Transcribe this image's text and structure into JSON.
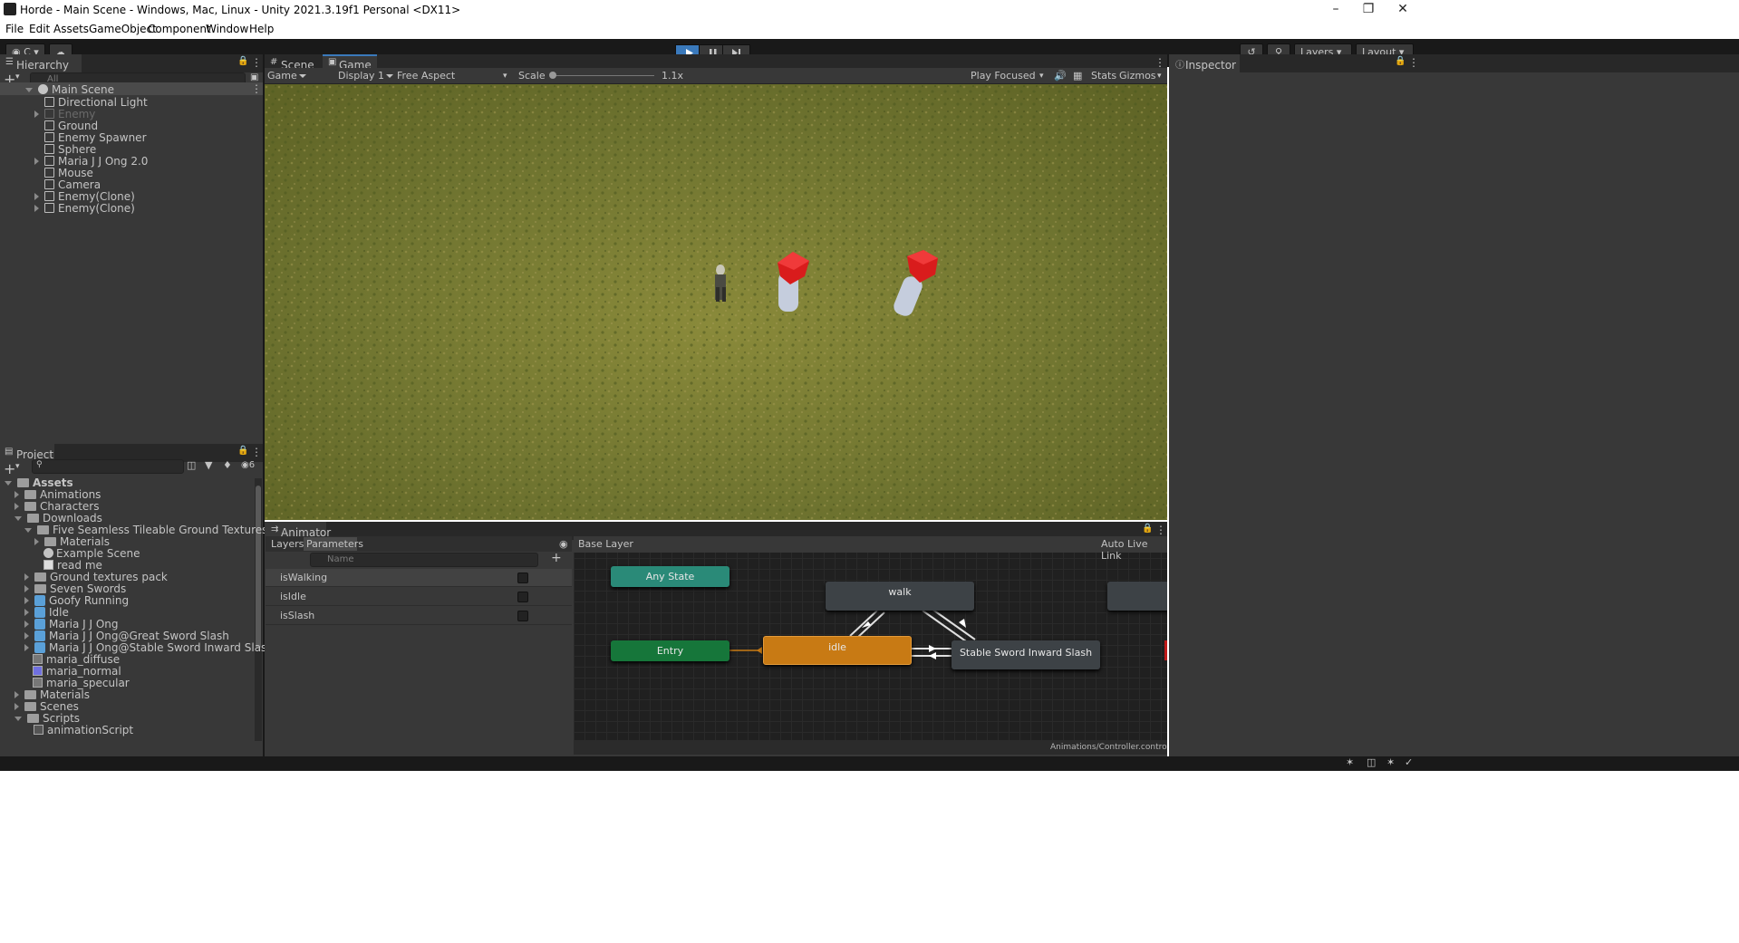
{
  "window": {
    "title": "Horde - Main Scene - Windows, Mac, Linux - Unity 2021.3.19f1 Personal <DX11>"
  },
  "menu": [
    "File",
    "Edit",
    "Assets",
    "GameObject",
    "Component",
    "Window",
    "Help"
  ],
  "toolbar": {
    "account": "C",
    "layers": "Layers",
    "layout": "Layout"
  },
  "hierarchy": {
    "tab": "Hierarchy",
    "search_placeholder": "All",
    "scene": "Main Scene",
    "items": [
      "Directional Light",
      "Enemy",
      "Ground",
      "Enemy Spawner",
      "Sphere",
      "Maria J J Ong 2.0",
      "Mouse",
      "Camera",
      "Enemy(Clone)",
      "Enemy(Clone)"
    ]
  },
  "center_tabs": {
    "scene": "Scene",
    "game": "Game"
  },
  "game_toolbar": {
    "mode": "Game",
    "display": "Display 1",
    "aspect": "Free Aspect",
    "scale_label": "Scale",
    "scale_value": "1.1x",
    "play_focused": "Play Focused",
    "stats": "Stats",
    "gizmos": "Gizmos"
  },
  "inspector": {
    "tab": "Inspector"
  },
  "project": {
    "tab": "Project",
    "hidden_count": "6",
    "tree": [
      "Assets",
      "Animations",
      "Characters",
      "Downloads",
      "Five Seamless Tileable Ground Textures",
      "Materials",
      "Example Scene",
      "read me",
      "Ground textures pack",
      "Seven Swords",
      "Goofy Running",
      "Idle",
      "Maria J J Ong",
      "Maria J J Ong@Great Sword Slash",
      "Maria J J Ong@Stable Sword Inward Slash",
      "maria_diffuse",
      "maria_normal",
      "maria_specular",
      "Materials",
      "Scenes",
      "Scripts",
      "animationScript"
    ]
  },
  "animator": {
    "tab": "Animator",
    "layers_tab": "Layers",
    "params_tab": "Parameters",
    "name_placeholder": "Name",
    "params": [
      "isWalking",
      "isIdle",
      "isSlash"
    ],
    "breadcrumb": "Base Layer",
    "auto_live_link": "Auto Live Link",
    "states": {
      "any": "Any State",
      "entry": "Entry",
      "idle": "idle",
      "walk": "walk",
      "slash": "Stable Sword Inward Slash"
    },
    "footer": "Animations/Controller.controller"
  },
  "colors": {
    "accent": "#3a79bb",
    "entry": "#16763a",
    "any_state": "#2a8a78",
    "idle": "#c87a14",
    "enemy_head": "#d91c1c"
  }
}
